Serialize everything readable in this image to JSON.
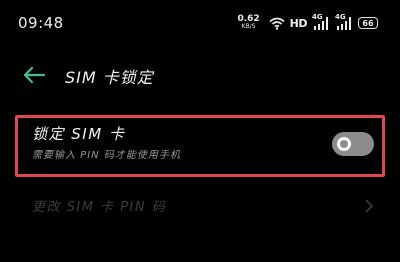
{
  "status_bar": {
    "time": "09:48",
    "net_speed_value": "0.62",
    "net_speed_unit": "KB/S",
    "hd_label": "HD",
    "signal1_label": "4G",
    "signal2_label": "4G",
    "battery": "66"
  },
  "header": {
    "title": "SIM 卡锁定"
  },
  "lock_row": {
    "title": "锁定 SIM 卡",
    "subtitle": "需要输入 PIN 码才能使用手机",
    "enabled": false
  },
  "change_pin_row": {
    "label": "更改 SIM 卡 PIN 码"
  }
}
